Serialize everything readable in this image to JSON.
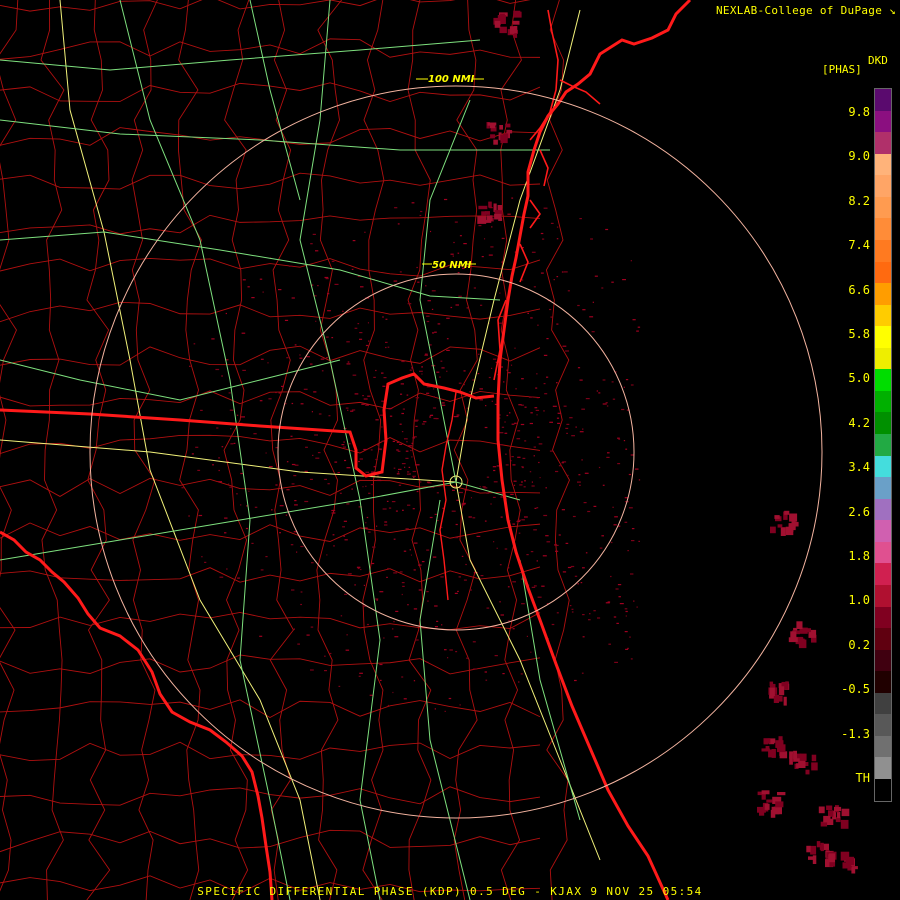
{
  "header": {
    "source_label": "NEXLAB-College of DuPage ↘"
  },
  "legend": {
    "product_code": "DKD",
    "unit": "[PHAS]",
    "ticks": [
      "9.8",
      "9.0",
      "8.2",
      "7.4",
      "6.6",
      "5.8",
      "5.0",
      "4.2",
      "3.4",
      "2.6",
      "1.8",
      "1.0",
      "0.2",
      "-0.5",
      "-1.3",
      "TH"
    ],
    "colors": [
      "#5a0a6e",
      "#8b0f80",
      "#b0306a",
      "#ffb37a",
      "#ffa566",
      "#ff9b50",
      "#ff8c38",
      "#ff7a20",
      "#ff6a10",
      "#ff9d00",
      "#ffcc00",
      "#ffff00",
      "#eeee00",
      "#00dd00",
      "#00b000",
      "#009000",
      "#22aa44",
      "#44dddd",
      "#6aa0c8",
      "#a070c0",
      "#d060b0",
      "#e05090",
      "#d02050",
      "#b01030",
      "#800020",
      "#600010",
      "#400010",
      "#200000",
      "#404040",
      "#585858",
      "#707070",
      "#909090",
      "#000000"
    ]
  },
  "map": {
    "range_rings": [
      "50 NMI",
      "100 NMI"
    ],
    "colors": {
      "state_border": "#ff1a1a",
      "county_border": "#c81414",
      "coastline": "#ff1a1a",
      "highway": "#7ee07e",
      "interstate": "#f2f27a",
      "range_ring": "#f4b4a0",
      "echo": "#a00020"
    }
  },
  "footer": {
    "caption": "SPECIFIC DIFFERENTIAL PHASE (KDP) 0.5 DEG - KJAX 9 NOV 25 05:54"
  }
}
